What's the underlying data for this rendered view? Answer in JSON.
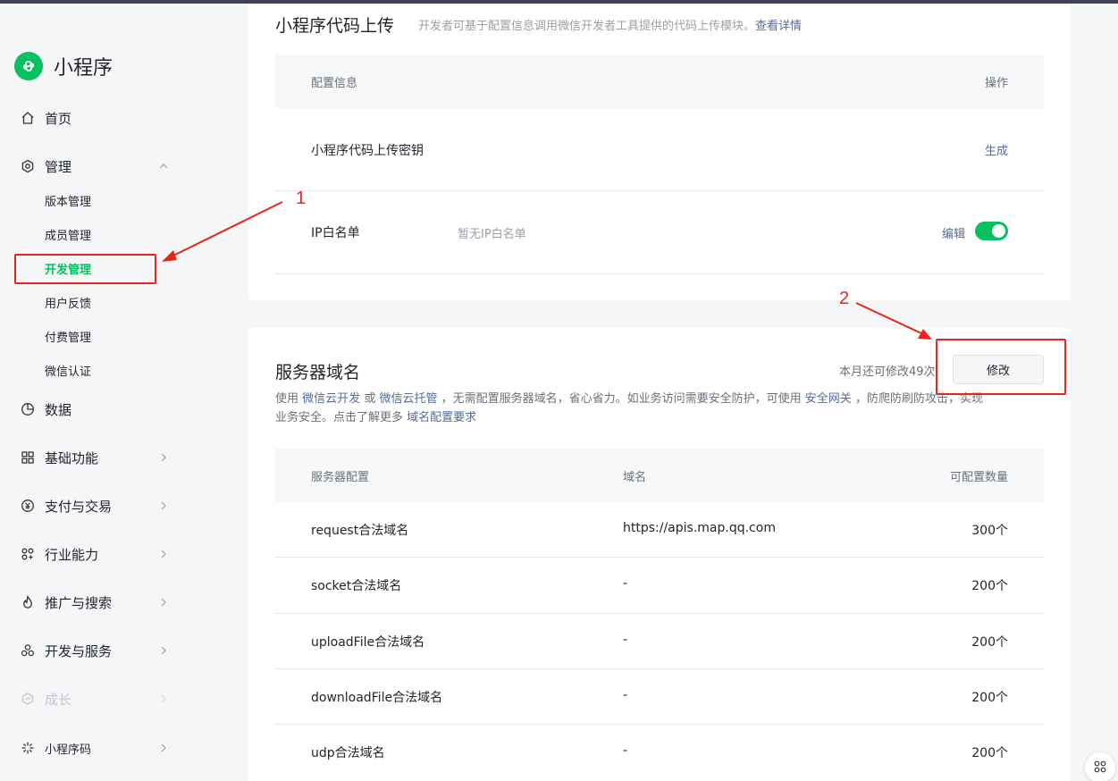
{
  "app": {
    "title": "小程序"
  },
  "sidebar": {
    "home": "首页",
    "manage": "管理",
    "manage_children": [
      "版本管理",
      "成员管理",
      "开发管理",
      "用户反馈",
      "付费管理",
      "微信认证"
    ],
    "data": "数据",
    "basic": "基础功能",
    "pay": "支付与交易",
    "industry": "行业能力",
    "promote": "推广与搜索",
    "devservice": "开发与服务",
    "growth": "成长",
    "qrcode": "小程序码"
  },
  "upload_card": {
    "title": "小程序代码上传",
    "desc": "开发者可基于配置信息调用微信开发者工具提供的代码上传模块。",
    "desc_link": "查看详情",
    "col_config": "配置信息",
    "col_action": "操作",
    "key_label": "小程序代码上传密钥",
    "key_action": "生成",
    "ip_label": "IP白名单",
    "ip_value": "暂无IP白名单",
    "ip_action": "编辑",
    "ip_toggle_on": true
  },
  "server_card": {
    "title": "服务器域名",
    "remaining": "本月还可修改49次",
    "modify_btn": "修改",
    "desc_p1": "使用",
    "desc_link1": "微信云开发",
    "desc_p2": "或",
    "desc_link2": "微信云托管",
    "desc_p3": "，无需配置服务器域名，省心省力。如业务访问需要安全防护，可使用",
    "desc_link3": "安全网关",
    "desc_p4": "，防爬防刷防攻击，实现",
    "desc_line2": "业务安全。点击了解更多",
    "desc_link4": "域名配置要求",
    "col_config": "服务器配置",
    "col_domain": "域名",
    "col_count": "可配置数量",
    "rows": [
      {
        "name": "request合法域名",
        "domain": "https://apis.map.qq.com",
        "count": "300个"
      },
      {
        "name": "socket合法域名",
        "domain": "-",
        "count": "200个"
      },
      {
        "name": "uploadFile合法域名",
        "domain": "-",
        "count": "200个"
      },
      {
        "name": "downloadFile合法域名",
        "domain": "-",
        "count": "200个"
      },
      {
        "name": "udp合法域名",
        "domain": "-",
        "count": "200个"
      }
    ]
  },
  "annotations": {
    "num1": "1",
    "num2": "2"
  },
  "colors": {
    "accent": "#07c160",
    "link": "#576b95",
    "annotation": "#e8251d"
  }
}
